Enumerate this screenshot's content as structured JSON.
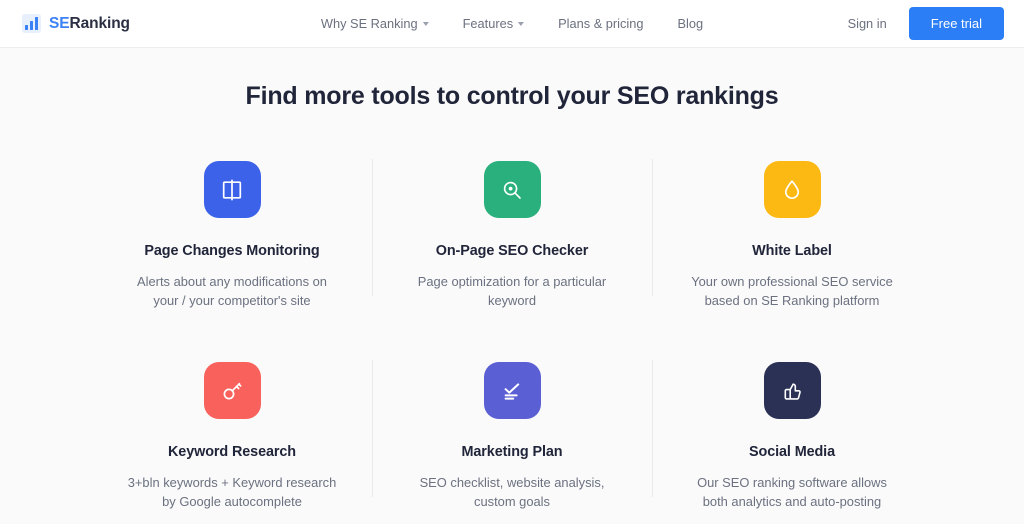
{
  "header": {
    "brand": {
      "prefix": "SE",
      "suffix": "Ranking",
      "icon": "bar-chart-logo-icon"
    },
    "nav": [
      {
        "label": "Why SE Ranking",
        "has_caret": true
      },
      {
        "label": "Features",
        "has_caret": true
      },
      {
        "label": "Plans & pricing",
        "has_caret": false
      },
      {
        "label": "Blog",
        "has_caret": false
      }
    ],
    "signin_label": "Sign in",
    "trial_label": "Free trial",
    "accent_color": "#2b7ef5"
  },
  "section": {
    "title": "Find more tools to control your SEO rankings",
    "cards": [
      {
        "title": "Page Changes Monitoring",
        "desc": "Alerts about any modifications on your / your competitor's site",
        "icon": "open-book-icon",
        "icon_bg": "#3d62ea"
      },
      {
        "title": "On-Page SEO Checker",
        "desc": "Page optimization for a particular keyword",
        "icon": "magnifier-target-icon",
        "icon_bg": "#2ab07c"
      },
      {
        "title": "White Label",
        "desc": "Your own professional SEO service based on SE Ranking platform",
        "icon": "water-drop-icon",
        "icon_bg": "#fdb913"
      },
      {
        "title": "Keyword Research",
        "desc": "3+bln keywords + Keyword research by Google autocomplete",
        "icon": "key-icon",
        "icon_bg": "#f9625c"
      },
      {
        "title": "Marketing Plan",
        "desc": "SEO checklist, website analysis, custom goals",
        "icon": "checklist-icon",
        "icon_bg": "#5b5fd4"
      },
      {
        "title": "Social Media",
        "desc": "Our SEO ranking software allows both analytics and auto-posting",
        "icon": "thumbs-up-icon",
        "icon_bg": "#2b3154"
      }
    ]
  }
}
